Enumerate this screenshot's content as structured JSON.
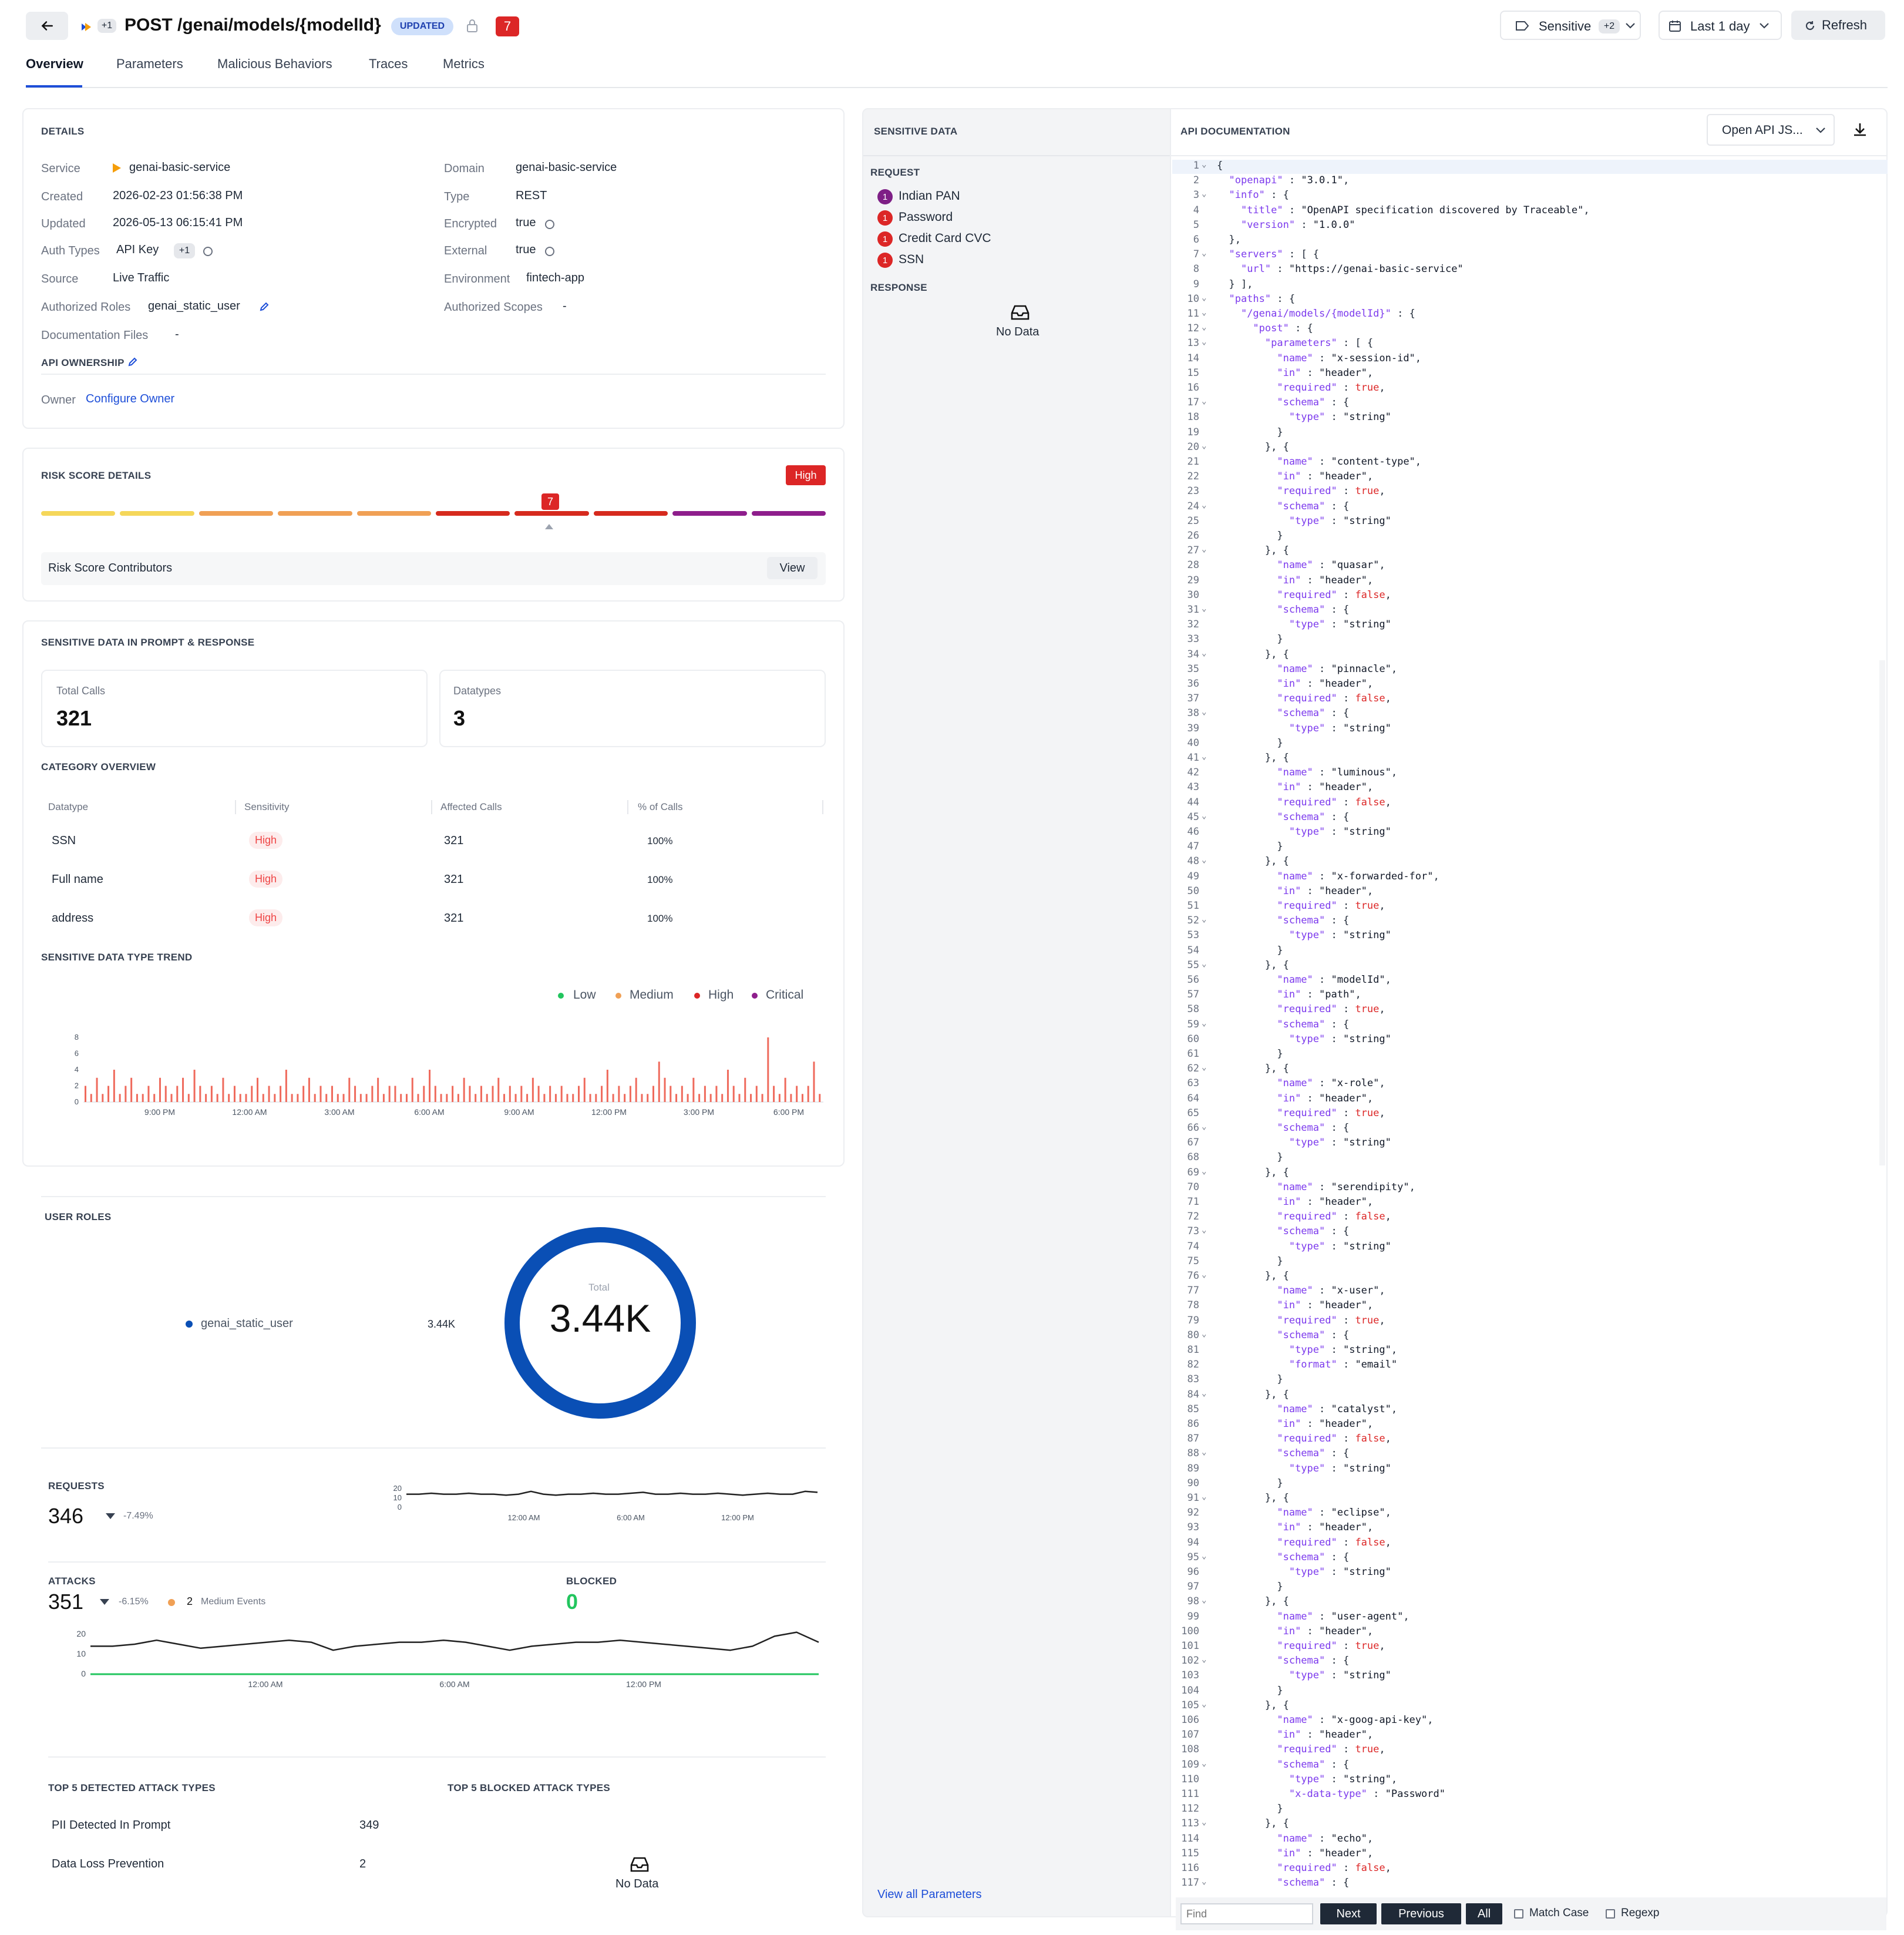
{
  "header": {
    "badge_plus": "+1",
    "title": "POST /genai/models/{modelId}",
    "updated_badge": "UPDATED",
    "risk_score": "7",
    "sensitive_filter": "Sensitive",
    "sensitive_more": "+2",
    "time_range": "Last 1 day",
    "refresh": "Refresh"
  },
  "tabs": [
    "Overview",
    "Parameters",
    "Malicious Behaviors",
    "Traces",
    "Metrics"
  ],
  "details": {
    "title": "DETAILS",
    "service_label": "Service",
    "service": "genai-basic-service",
    "domain_label": "Domain",
    "domain": "genai-basic-service",
    "created_label": "Created",
    "created": "2026-02-23 01:56:38 PM",
    "type_label": "Type",
    "type": "REST",
    "updated_label": "Updated",
    "updated": "2026-05-13 06:15:41 PM",
    "encrypted_label": "Encrypted",
    "encrypted": "true",
    "auth_label": "Auth Types",
    "auth": "API Key",
    "auth_more": "+1",
    "external_label": "External",
    "external": "true",
    "source_label": "Source",
    "source": "Live Traffic",
    "environment_label": "Environment",
    "environment": "fintech-app",
    "roles_label": "Authorized Roles",
    "roles": "genai_static_user",
    "scopes_label": "Authorized Scopes",
    "scopes": "-",
    "docs_label": "Documentation Files",
    "docs": "-",
    "ownership_title": "API OWNERSHIP",
    "owner_label": "Owner",
    "owner_link": "Configure Owner"
  },
  "risk": {
    "title": "RISK SCORE DETAILS",
    "level": "High",
    "score": "7",
    "contributors": "Risk Score Contributors",
    "view": "View",
    "colors": [
      "#f5d75a",
      "#f5d75a",
      "#f0a055",
      "#f0a055",
      "#f0a055",
      "#d62a1e",
      "#d62a1e",
      "#d62a1e",
      "#8e1e8c",
      "#8e1e8c"
    ]
  },
  "sensitive_prompt": {
    "title": "SENSITIVE DATA IN PROMPT & RESPONSE",
    "total_calls_label": "Total Calls",
    "total_calls": "321",
    "datatypes_label": "Datatypes",
    "datatypes": "3",
    "category_title": "CATEGORY OVERVIEW",
    "columns": [
      "Datatype",
      "Sensitivity",
      "Affected Calls",
      "% of Calls"
    ],
    "rows": [
      {
        "datatype": "SSN",
        "sensitivity": "High",
        "calls": "321",
        "pct": "100%"
      },
      {
        "datatype": "Full name",
        "sensitivity": "High",
        "calls": "321",
        "pct": "100%"
      },
      {
        "datatype": "address",
        "sensitivity": "High",
        "calls": "321",
        "pct": "100%"
      }
    ],
    "trend_title": "SENSITIVE DATA TYPE TREND",
    "legend": [
      {
        "name": "Low",
        "color": "#22c55e"
      },
      {
        "name": "Medium",
        "color": "#f0a055"
      },
      {
        "name": "High",
        "color": "#dc2626"
      },
      {
        "name": "Critical",
        "color": "#8e1e8c"
      }
    ]
  },
  "user_roles": {
    "title": "USER ROLES",
    "role": "genai_static_user",
    "role_value": "3.44K",
    "total_label": "Total",
    "total": "3.44K"
  },
  "requests": {
    "title": "REQUESTS",
    "value": "346",
    "delta": "-7.49%"
  },
  "attacks": {
    "title": "ATTACKS",
    "value": "351",
    "delta": "-6.15%",
    "medium_count": "2",
    "medium_label": "Medium Events",
    "blocked_title": "BLOCKED",
    "blocked": "0"
  },
  "top_attacks": {
    "detected_title": "TOP 5 DETECTED ATTACK TYPES",
    "blocked_title": "TOP 5 BLOCKED ATTACK TYPES",
    "detected": [
      {
        "name": "PII Detected In Prompt",
        "count": "349"
      },
      {
        "name": "Data Loss Prevention",
        "count": "2"
      }
    ],
    "no_data": "No Data"
  },
  "sensitive_panel": {
    "title": "SENSITIVE DATA",
    "request_label": "REQUEST",
    "items": [
      {
        "count": "1",
        "name": "Indian PAN",
        "color": "#7e1f86"
      },
      {
        "count": "1",
        "name": "Password",
        "color": "#dc2626"
      },
      {
        "count": "1",
        "name": "Credit Card CVC",
        "color": "#dc2626"
      },
      {
        "count": "1",
        "name": "SSN",
        "color": "#dc2626"
      }
    ],
    "response_label": "RESPONSE",
    "no_data": "No Data",
    "view_all": "View all Parameters"
  },
  "api_doc": {
    "title": "API DOCUMENTATION",
    "format": "Open API JS...",
    "find_placeholder": "Find",
    "next": "Next",
    "previous": "Previous",
    "all": "All",
    "match_case": "Match Case",
    "regexp": "Regexp"
  },
  "chart_data": [
    {
      "type": "bar",
      "title": "SENSITIVE DATA TYPE TREND",
      "x_ticks": [
        "9:00 PM",
        "12:00 AM",
        "3:00 AM",
        "6:00 AM",
        "9:00 AM",
        "12:00 PM",
        "3:00 PM",
        "6:00 PM"
      ],
      "y_ticks": [
        0,
        2,
        4,
        6,
        8
      ],
      "ylim": [
        0,
        8
      ],
      "series": [
        {
          "name": "High",
          "values": [
            2,
            1,
            3,
            1,
            2,
            4,
            1,
            2,
            3,
            1,
            1,
            2,
            1,
            3,
            2,
            1,
            2,
            3,
            1,
            4,
            2,
            1,
            2,
            1,
            3,
            1,
            2,
            1,
            1,
            2,
            3,
            1,
            2,
            1,
            2,
            4,
            1,
            1,
            2,
            3,
            1,
            2,
            1,
            2,
            1,
            1,
            3,
            2,
            1,
            1,
            2,
            3,
            1,
            2,
            2,
            1,
            1,
            3,
            1,
            2,
            4,
            2,
            1,
            1,
            2,
            1,
            3,
            2,
            1,
            2,
            1,
            2,
            3,
            1,
            2,
            1,
            2,
            1,
            3,
            2,
            1,
            2,
            1,
            2,
            1,
            1,
            2,
            3,
            1,
            1,
            2,
            4,
            1,
            2,
            1,
            2,
            3,
            1,
            1,
            2,
            5,
            3,
            2,
            1,
            2,
            1,
            3,
            1,
            2,
            1,
            2,
            1,
            4,
            2,
            1,
            3,
            1,
            2,
            1,
            8,
            2,
            1,
            3,
            1,
            2,
            1,
            2,
            5,
            1
          ]
        }
      ]
    },
    {
      "type": "line",
      "title": "REQUESTS",
      "x_ticks": [
        "12:00 AM",
        "6:00 AM",
        "12:00 PM"
      ],
      "y_ticks": [
        0,
        10,
        20
      ],
      "ylim": [
        0,
        20
      ],
      "series": [
        {
          "name": "Requests",
          "values": [
            14,
            14,
            15,
            14,
            14,
            15,
            14,
            14,
            13,
            14,
            17,
            14,
            13,
            14,
            14,
            15,
            14,
            14,
            15,
            16,
            14,
            14,
            15,
            14,
            14,
            15,
            14,
            13,
            14,
            15,
            14,
            14,
            17,
            16
          ]
        }
      ]
    },
    {
      "type": "line",
      "title": "ATTACKS",
      "x_ticks": [
        "12:00 AM",
        "6:00 AM",
        "12:00 PM"
      ],
      "y_ticks": [
        0,
        10,
        20
      ],
      "ylim": [
        0,
        20
      ],
      "series": [
        {
          "name": "Attacks",
          "values": [
            14,
            14,
            15,
            17,
            15,
            13,
            14,
            15,
            16,
            17,
            16,
            12,
            14,
            15,
            16,
            16,
            17,
            16,
            14,
            12,
            14,
            15,
            16,
            16,
            17,
            16,
            15,
            14,
            13,
            12,
            14,
            19,
            21,
            16
          ]
        },
        {
          "name": "Blocked",
          "values": [
            0,
            0,
            0,
            0,
            0,
            0,
            0,
            0,
            0,
            0,
            0,
            0,
            0,
            0,
            0,
            0,
            0,
            0,
            0,
            0,
            0,
            0,
            0,
            0,
            0,
            0,
            0,
            0,
            0,
            0,
            0,
            0,
            0,
            0
          ]
        }
      ]
    },
    {
      "type": "pie",
      "title": "USER ROLES",
      "categories": [
        "genai_static_user"
      ],
      "values": [
        3440
      ]
    }
  ],
  "code_lines": [
    "{",
    "  \"openapi\" : \"3.0.1\",",
    "  \"info\" : {",
    "    \"title\" : \"OpenAPI specification discovered by Traceable\",",
    "    \"version\" : \"1.0.0\"",
    "  },",
    "  \"servers\" : [ {",
    "    \"url\" : \"https://genai-basic-service\"",
    "  } ],",
    "  \"paths\" : {",
    "    \"/genai/models/{modelId}\" : {",
    "      \"post\" : {",
    "        \"parameters\" : [ {",
    "          \"name\" : \"x-session-id\",",
    "          \"in\" : \"header\",",
    "          \"required\" : true,",
    "          \"schema\" : {",
    "            \"type\" : \"string\"",
    "          }",
    "        }, {",
    "          \"name\" : \"content-type\",",
    "          \"in\" : \"header\",",
    "          \"required\" : true,",
    "          \"schema\" : {",
    "            \"type\" : \"string\"",
    "          }",
    "        }, {",
    "          \"name\" : \"quasar\",",
    "          \"in\" : \"header\",",
    "          \"required\" : false,",
    "          \"schema\" : {",
    "            \"type\" : \"string\"",
    "          }",
    "        }, {",
    "          \"name\" : \"pinnacle\",",
    "          \"in\" : \"header\",",
    "          \"required\" : false,",
    "          \"schema\" : {",
    "            \"type\" : \"string\"",
    "          }",
    "        }, {",
    "          \"name\" : \"luminous\",",
    "          \"in\" : \"header\",",
    "          \"required\" : false,",
    "          \"schema\" : {",
    "            \"type\" : \"string\"",
    "          }",
    "        }, {",
    "          \"name\" : \"x-forwarded-for\",",
    "          \"in\" : \"header\",",
    "          \"required\" : true,",
    "          \"schema\" : {",
    "            \"type\" : \"string\"",
    "          }",
    "        }, {",
    "          \"name\" : \"modelId\",",
    "          \"in\" : \"path\",",
    "          \"required\" : true,",
    "          \"schema\" : {",
    "            \"type\" : \"string\"",
    "          }",
    "        }, {",
    "          \"name\" : \"x-role\",",
    "          \"in\" : \"header\",",
    "          \"required\" : true,",
    "          \"schema\" : {",
    "            \"type\" : \"string\"",
    "          }",
    "        }, {",
    "          \"name\" : \"serendipity\",",
    "          \"in\" : \"header\",",
    "          \"required\" : false,",
    "          \"schema\" : {",
    "            \"type\" : \"string\"",
    "          }",
    "        }, {",
    "          \"name\" : \"x-user\",",
    "          \"in\" : \"header\",",
    "          \"required\" : true,",
    "          \"schema\" : {",
    "            \"type\" : \"string\",",
    "            \"format\" : \"email\"",
    "          }",
    "        }, {",
    "          \"name\" : \"catalyst\",",
    "          \"in\" : \"header\",",
    "          \"required\" : false,",
    "          \"schema\" : {",
    "            \"type\" : \"string\"",
    "          }",
    "        }, {",
    "          \"name\" : \"eclipse\",",
    "          \"in\" : \"header\",",
    "          \"required\" : false,",
    "          \"schema\" : {",
    "            \"type\" : \"string\"",
    "          }",
    "        }, {",
    "          \"name\" : \"user-agent\",",
    "          \"in\" : \"header\",",
    "          \"required\" : true,",
    "          \"schema\" : {",
    "            \"type\" : \"string\"",
    "          }",
    "        }, {",
    "          \"name\" : \"x-goog-api-key\",",
    "          \"in\" : \"header\",",
    "          \"required\" : true,",
    "          \"schema\" : {",
    "            \"type\" : \"string\",",
    "            \"x-data-type\" : \"Password\"",
    "          }",
    "        }, {",
    "          \"name\" : \"echo\",",
    "          \"in\" : \"header\",",
    "          \"required\" : false,",
    "          \"schema\" : {"
  ]
}
